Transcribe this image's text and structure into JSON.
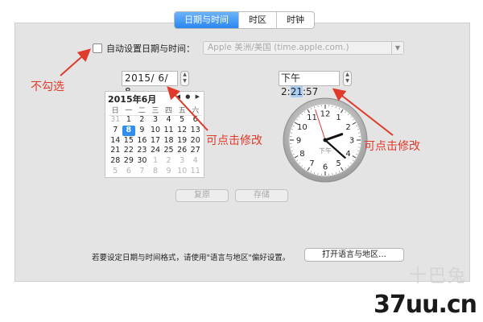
{
  "tabs": [
    {
      "label": "日期与时间",
      "active": true
    },
    {
      "label": "时区",
      "active": false
    },
    {
      "label": "时钟",
      "active": false
    }
  ],
  "auto_set": {
    "label": "自动设置日期与时间：",
    "checked": false
  },
  "time_server": {
    "value": "Apple 美洲/美国 (time.apple.com.)"
  },
  "date_field": {
    "value": "2015/ 6/ 8"
  },
  "time_field": {
    "ampm": "下午",
    "before_sel": " 2:",
    "selected": "21",
    "after_sel": ":57"
  },
  "calendar": {
    "month_label": "2015年6月",
    "nav": "◀ ● ▶",
    "weekdays": [
      "日",
      "一",
      "二",
      "三",
      "四",
      "五",
      "六"
    ],
    "selected_day": 8,
    "days": [
      {
        "d": "31",
        "dim": true
      },
      {
        "d": "1"
      },
      {
        "d": "2"
      },
      {
        "d": "3"
      },
      {
        "d": "4"
      },
      {
        "d": "5"
      },
      {
        "d": "6"
      },
      {
        "d": "7"
      },
      {
        "d": "8"
      },
      {
        "d": "9"
      },
      {
        "d": "10"
      },
      {
        "d": "11"
      },
      {
        "d": "12"
      },
      {
        "d": "13"
      },
      {
        "d": "14"
      },
      {
        "d": "15"
      },
      {
        "d": "16"
      },
      {
        "d": "17"
      },
      {
        "d": "18"
      },
      {
        "d": "19"
      },
      {
        "d": "20"
      },
      {
        "d": "21"
      },
      {
        "d": "22"
      },
      {
        "d": "23"
      },
      {
        "d": "24"
      },
      {
        "d": "25"
      },
      {
        "d": "26"
      },
      {
        "d": "27"
      },
      {
        "d": "28"
      },
      {
        "d": "29"
      },
      {
        "d": "30"
      },
      {
        "d": "1",
        "dim": true
      },
      {
        "d": "2",
        "dim": true
      },
      {
        "d": "3",
        "dim": true
      },
      {
        "d": "4",
        "dim": true
      },
      {
        "d": "5",
        "dim": true
      },
      {
        "d": "6",
        "dim": true
      },
      {
        "d": "7",
        "dim": true
      },
      {
        "d": "8",
        "dim": true
      },
      {
        "d": "9",
        "dim": true
      },
      {
        "d": "10",
        "dim": true
      },
      {
        "d": "11",
        "dim": true
      }
    ]
  },
  "clock": {
    "numbers": [
      "12",
      "1",
      "2",
      "3",
      "4",
      "5",
      "6",
      "7",
      "8",
      "9",
      "10",
      "11"
    ],
    "ampm": "下午",
    "hour": 2,
    "minute": 21,
    "second": 57
  },
  "buttons": {
    "revert": "复原",
    "save": "存储"
  },
  "footer": {
    "text": "若要设定日期与时间格式，请使用\"语言与地区\"偏好设置。",
    "lang_button": "打开语言与地区…"
  },
  "annotations": {
    "no_check": "不勾选",
    "click_edit_1": "可点击修改",
    "click_edit_2": "可点击修改"
  },
  "watermark": {
    "site": "37uu.cn",
    "cn": "十巴兔"
  },
  "colors": {
    "accent": "#2f8ef0",
    "annotation": "#e03a2a",
    "panel": "#e4e4e4"
  }
}
